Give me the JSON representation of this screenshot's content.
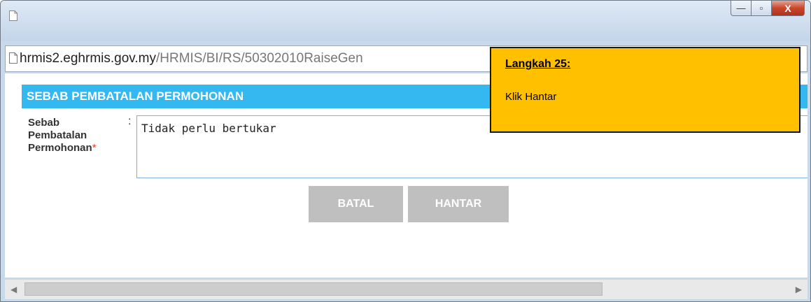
{
  "address_bar": {
    "domain": "hrmis2.eghrmis.gov.my",
    "path": "/HRMIS/BI/RS/50302010RaiseGen"
  },
  "window_controls": {
    "minimize": "—",
    "maximize": "▫",
    "close": "X"
  },
  "form": {
    "section_title": "SEBAB PEMBATALAN PERMOHONAN",
    "field_label_line1": "Sebab",
    "field_label_line2": "Pembatalan",
    "field_label_line3": "Permohonan",
    "required_marker": "*",
    "colon": ":",
    "reason_value": "Tidak perlu bertukar",
    "accent_color": "#33b8f0"
  },
  "buttons": {
    "cancel_label": "BATAL",
    "submit_label": "HANTAR"
  },
  "callout": {
    "title": "Langkah 25:",
    "body": "Klik Hantar",
    "color": "#ffc000"
  },
  "icons": {
    "window_doc": "document-icon",
    "address_doc": "page-icon"
  }
}
